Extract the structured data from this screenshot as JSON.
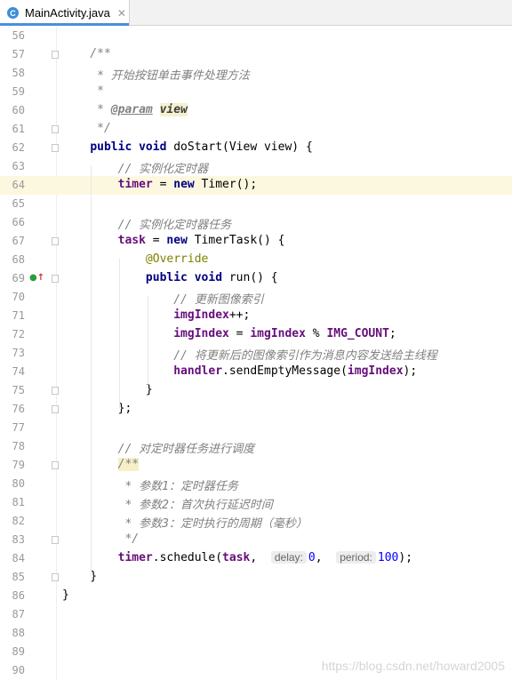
{
  "tab": {
    "icon_letter": "C",
    "title": "MainActivity.java",
    "close_glyph": "✕"
  },
  "current_line": 64,
  "lines": [
    {
      "n": "56",
      "tokens": []
    },
    {
      "n": "57",
      "tokens": [
        {
          "t": "    /**",
          "c": "cm"
        }
      ],
      "fold": true
    },
    {
      "n": "58",
      "tokens": [
        {
          "t": "     * 开始按钮单击事件处理方法",
          "c": "cm"
        }
      ]
    },
    {
      "n": "59",
      "tokens": [
        {
          "t": "     *",
          "c": "cm"
        }
      ]
    },
    {
      "n": "60",
      "tokens": [
        {
          "t": "     * ",
          "c": "cm"
        },
        {
          "t": "@param",
          "c": "tag"
        },
        {
          "t": " ",
          "c": "cm"
        },
        {
          "t": "view",
          "c": "pname"
        }
      ]
    },
    {
      "n": "61",
      "tokens": [
        {
          "t": "     */",
          "c": "cm"
        }
      ],
      "fold": true
    },
    {
      "n": "62",
      "tokens": [
        {
          "t": "    "
        },
        {
          "t": "public void",
          "c": "kw"
        },
        {
          "t": " doStart(View view) {"
        }
      ],
      "fold": true
    },
    {
      "n": "63",
      "tokens": [
        {
          "t": "        // 实例化定时器",
          "c": "cm"
        }
      ]
    },
    {
      "n": "64",
      "tokens": [
        {
          "t": "        "
        },
        {
          "t": "timer",
          "c": "fld"
        },
        {
          "t": " = "
        },
        {
          "t": "new",
          "c": "kw"
        },
        {
          "t": " Timer();"
        }
      ]
    },
    {
      "n": "65",
      "tokens": []
    },
    {
      "n": "66",
      "tokens": [
        {
          "t": "        // 实例化定时器任务",
          "c": "cm"
        }
      ]
    },
    {
      "n": "67",
      "tokens": [
        {
          "t": "        "
        },
        {
          "t": "task",
          "c": "fld"
        },
        {
          "t": " = "
        },
        {
          "t": "new",
          "c": "kw"
        },
        {
          "t": " TimerTask() {"
        }
      ],
      "fold": true
    },
    {
      "n": "68",
      "tokens": [
        {
          "t": "            "
        },
        {
          "t": "@Override",
          "c": "ann"
        }
      ]
    },
    {
      "n": "69",
      "tokens": [
        {
          "t": "            "
        },
        {
          "t": "public void",
          "c": "kw"
        },
        {
          "t": " run() {"
        }
      ],
      "fold": true,
      "override_icon": true
    },
    {
      "n": "70",
      "tokens": [
        {
          "t": "                // 更新图像索引",
          "c": "cm"
        }
      ]
    },
    {
      "n": "71",
      "tokens": [
        {
          "t": "                "
        },
        {
          "t": "imgIndex",
          "c": "fld"
        },
        {
          "t": "++;"
        }
      ]
    },
    {
      "n": "72",
      "tokens": [
        {
          "t": "                "
        },
        {
          "t": "imgIndex",
          "c": "fld"
        },
        {
          "t": " = "
        },
        {
          "t": "imgIndex",
          "c": "fld"
        },
        {
          "t": " % "
        },
        {
          "t": "IMG_COUNT",
          "c": "fld"
        },
        {
          "t": ";"
        }
      ]
    },
    {
      "n": "73",
      "tokens": [
        {
          "t": "                // 将更新后的图像索引作为消息内容发送给主线程",
          "c": "cm"
        }
      ]
    },
    {
      "n": "74",
      "tokens": [
        {
          "t": "                "
        },
        {
          "t": "handler",
          "c": "fld"
        },
        {
          "t": ".sendEmptyMessage("
        },
        {
          "t": "imgIndex",
          "c": "fld"
        },
        {
          "t": ");"
        }
      ]
    },
    {
      "n": "75",
      "tokens": [
        {
          "t": "            }"
        }
      ],
      "fold": true
    },
    {
      "n": "76",
      "tokens": [
        {
          "t": "        };"
        }
      ],
      "fold": true
    },
    {
      "n": "77",
      "tokens": []
    },
    {
      "n": "78",
      "tokens": [
        {
          "t": "        // 对定时器任务进行调度",
          "c": "cm"
        }
      ]
    },
    {
      "n": "79",
      "tokens": [
        {
          "t": "        "
        },
        {
          "t": "/**",
          "c": "cm hl-comment"
        }
      ],
      "fold": true
    },
    {
      "n": "80",
      "tokens": [
        {
          "t": "         * 参数1：定时器任务",
          "c": "cm"
        }
      ]
    },
    {
      "n": "81",
      "tokens": [
        {
          "t": "         * 参数2：首次执行延迟时间",
          "c": "cm"
        }
      ]
    },
    {
      "n": "82",
      "tokens": [
        {
          "t": "         * 参数3：定时执行的周期（毫秒）",
          "c": "cm"
        }
      ]
    },
    {
      "n": "83",
      "tokens": [
        {
          "t": "         */",
          "c": "cm"
        }
      ],
      "fold": true
    },
    {
      "n": "84",
      "tokens": [
        {
          "t": "        "
        },
        {
          "t": "timer",
          "c": "fld"
        },
        {
          "t": ".schedule("
        },
        {
          "t": "task",
          "c": "fld"
        },
        {
          "t": ",  "
        },
        {
          "t": "delay:",
          "c": "hint"
        },
        {
          "t": "0",
          "c": "num"
        },
        {
          "t": ",  "
        },
        {
          "t": "period:",
          "c": "hint"
        },
        {
          "t": "100",
          "c": "num"
        },
        {
          "t": ");"
        }
      ]
    },
    {
      "n": "85",
      "tokens": [
        {
          "t": "    }"
        }
      ],
      "fold": true
    },
    {
      "n": "86",
      "tokens": [
        {
          "t": "}"
        }
      ]
    },
    {
      "n": "87",
      "tokens": []
    },
    {
      "n": "88",
      "tokens": []
    },
    {
      "n": "89",
      "tokens": []
    },
    {
      "n": "90",
      "tokens": []
    }
  ],
  "watermark": "https://blog.csdn.net/howard2005"
}
